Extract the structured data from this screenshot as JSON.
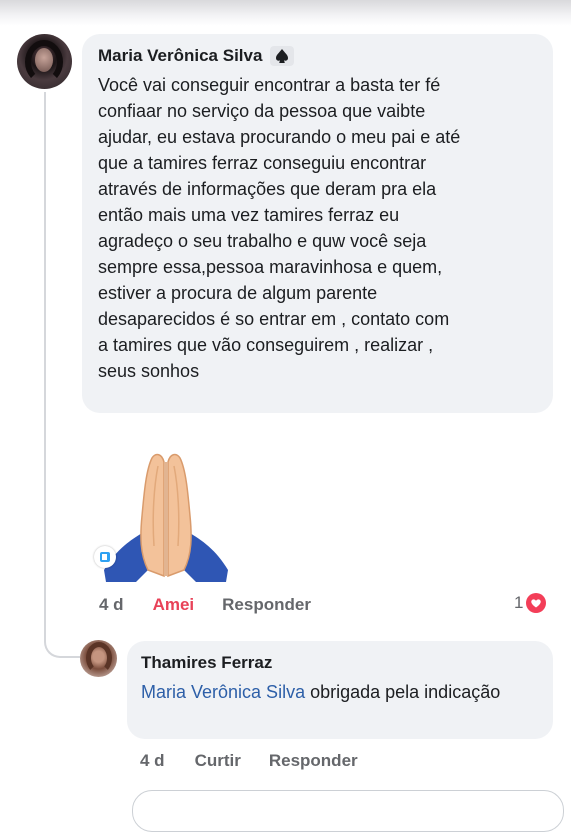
{
  "comment": {
    "author": "Maria Verônica Silva",
    "badge_icon": "spade-badge-icon",
    "text": "Você vai conseguir encontrar a basta ter fé\nconfiaar no serviço da pessoa que vaibte\najudar, eu estava procurando o meu pai e até\nque a tamires ferraz conseguiu encontrar\natravés de informações  que deram pra ela\nentão mais uma vez tamires ferraz eu\nagradeço o seu trabalho e quw você seja\nsempre essa,pessoa maravinhosa e quem,\nestiver a procura de algum parente\ndesaparecidos é so entrar em , contato com\na tamires que vão conseguirem , realizar ,\nseus sonhos",
    "sticker": "folded-hands-emoji",
    "time": "4 d",
    "reacted_label": "Amei",
    "reply_label": "Responder",
    "reaction_count": "1",
    "reaction_icon": "heart-reaction-icon"
  },
  "reply": {
    "author": "Thamires Ferraz",
    "mention": "Maria Verônica Silva",
    "text": " obrigada pela indicação",
    "time": "4 d",
    "like_label": "Curtir",
    "reply_label": "Responder"
  },
  "colors": {
    "bubble": "#f0f2f5",
    "love": "#e84258",
    "mention": "#2d5fa8",
    "muted": "#65676b"
  }
}
